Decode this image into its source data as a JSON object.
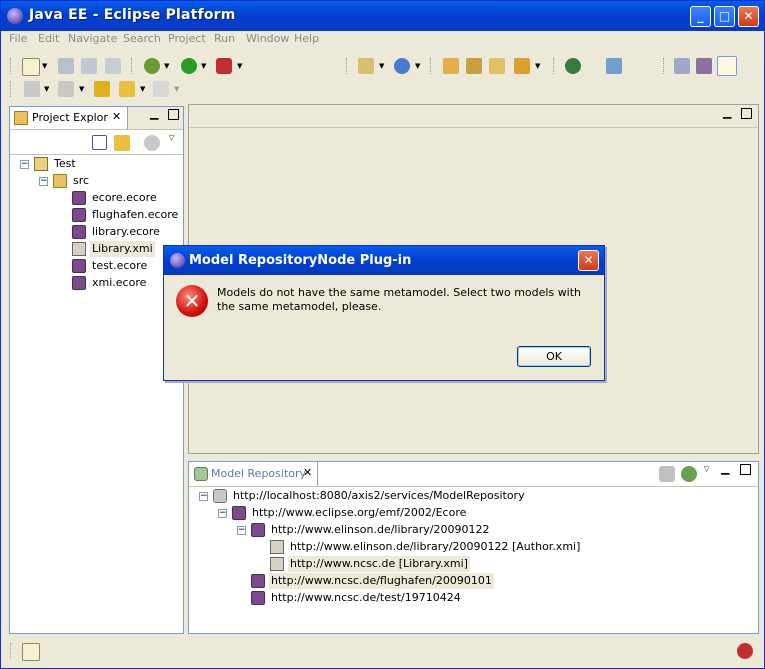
{
  "window": {
    "title": "Java EE - Eclipse Platform",
    "minimize_glyph": "_",
    "maximize_glyph": "□",
    "close_glyph": "✕"
  },
  "menu": [
    "File",
    "Edit",
    "Navigate",
    "Search",
    "Project",
    "Run",
    "Window",
    "Help"
  ],
  "project_explorer": {
    "tab_label": "Project Explor",
    "tree": [
      {
        "label": "Test",
        "icon": "project-icon",
        "depth": 0,
        "expanded": true
      },
      {
        "label": "src",
        "icon": "folder-icon",
        "depth": 1,
        "expanded": true
      },
      {
        "label": "ecore.ecore",
        "icon": "ecore-file-icon",
        "depth": 2
      },
      {
        "label": "flughafen.ecore",
        "icon": "ecore-file-icon",
        "depth": 2
      },
      {
        "label": "library.ecore",
        "icon": "ecore-file-icon",
        "depth": 2
      },
      {
        "label": "Library.xmi",
        "icon": "xmi-file-icon",
        "depth": 2,
        "selected": true
      },
      {
        "label": "test.ecore",
        "icon": "ecore-file-icon",
        "depth": 2
      },
      {
        "label": "xmi.ecore",
        "icon": "ecore-file-icon",
        "depth": 2
      }
    ]
  },
  "model_repository": {
    "tab_label": "Model Repository",
    "tree": [
      {
        "label": "http://localhost:8080/axis2/services/ModelRepository",
        "icon": "database-icon",
        "depth": 0,
        "expanded": true
      },
      {
        "label": "http://www.eclipse.org/emf/2002/Ecore",
        "icon": "ecore-model-icon",
        "depth": 1,
        "expanded": true
      },
      {
        "label": "http://www.elinson.de/library/20090122",
        "icon": "ecore-model-icon",
        "depth": 2,
        "expanded": true
      },
      {
        "label": "http://www.elinson.de/library/20090122 [Author.xmi]",
        "icon": "xmi-model-icon",
        "depth": 3
      },
      {
        "label": "http://www.ncsc.de [Library.xmi]",
        "icon": "xmi-model-icon",
        "depth": 3,
        "selected": true
      },
      {
        "label": "http://www.ncsc.de/flughafen/20090101",
        "icon": "ecore-model-icon",
        "depth": 2,
        "selected": true
      },
      {
        "label": "http://www.ncsc.de/test/19710424",
        "icon": "ecore-model-icon",
        "depth": 2
      }
    ]
  },
  "dialog": {
    "title": "Model RepositoryNode Plug-in",
    "message": "Models do not have the same metamodel. Select two models with the same metamodel, please.",
    "ok_label": "OK"
  },
  "colors": {
    "titlebar": "#0a5ce8",
    "selection": "#ece9d8",
    "error": "#d01010"
  }
}
